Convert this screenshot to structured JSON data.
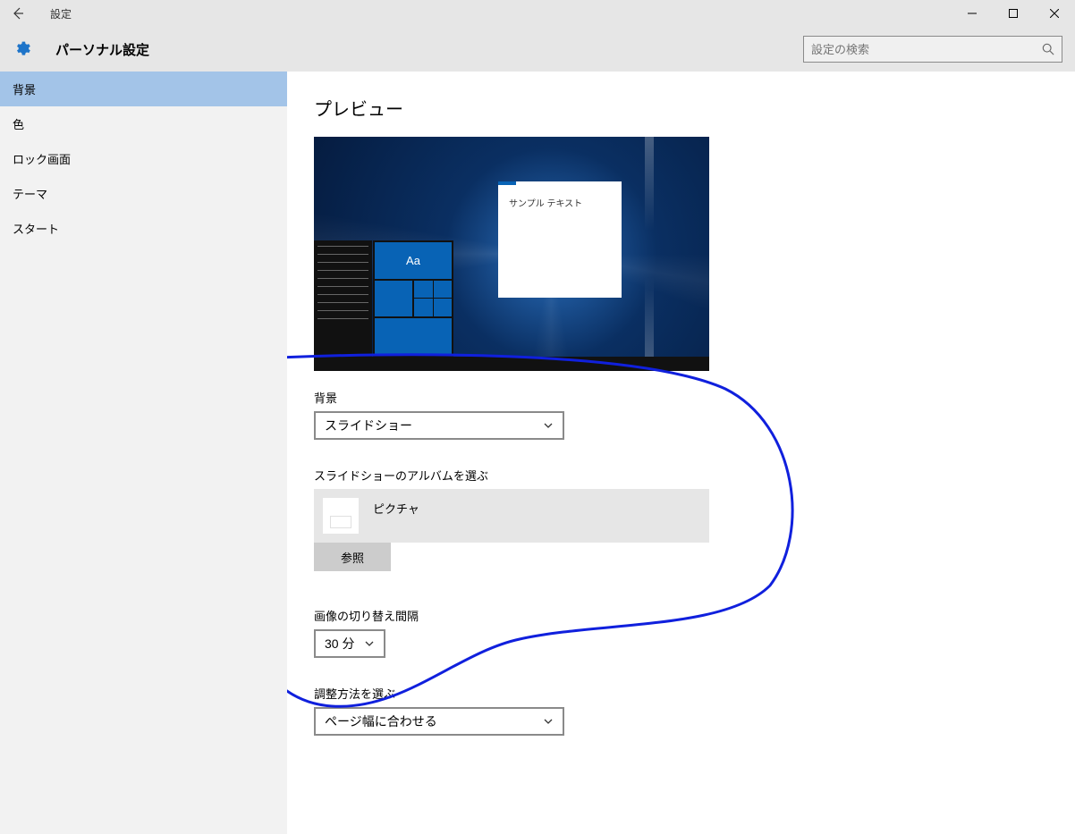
{
  "window": {
    "title": "設定"
  },
  "header": {
    "page_title": "パーソナル設定",
    "search_placeholder": "設定の検索"
  },
  "sidebar": {
    "items": [
      {
        "label": "背景",
        "selected": true
      },
      {
        "label": "色"
      },
      {
        "label": "ロック画面"
      },
      {
        "label": "テーマ"
      },
      {
        "label": "スタート"
      }
    ]
  },
  "main": {
    "preview_title": "プレビュー",
    "sample_text": "サンプル テキスト",
    "tile_text": "Aa",
    "background_label": "背景",
    "background_value": "スライドショー",
    "album_label": "スライドショーのアルバムを選ぶ",
    "album_name": "ピクチャ",
    "browse_label": "参照",
    "interval_label": "画像の切り替え間隔",
    "interval_value": "30 分",
    "fit_label": "調整方法を選ぶ",
    "fit_value": "ページ幅に合わせる"
  }
}
